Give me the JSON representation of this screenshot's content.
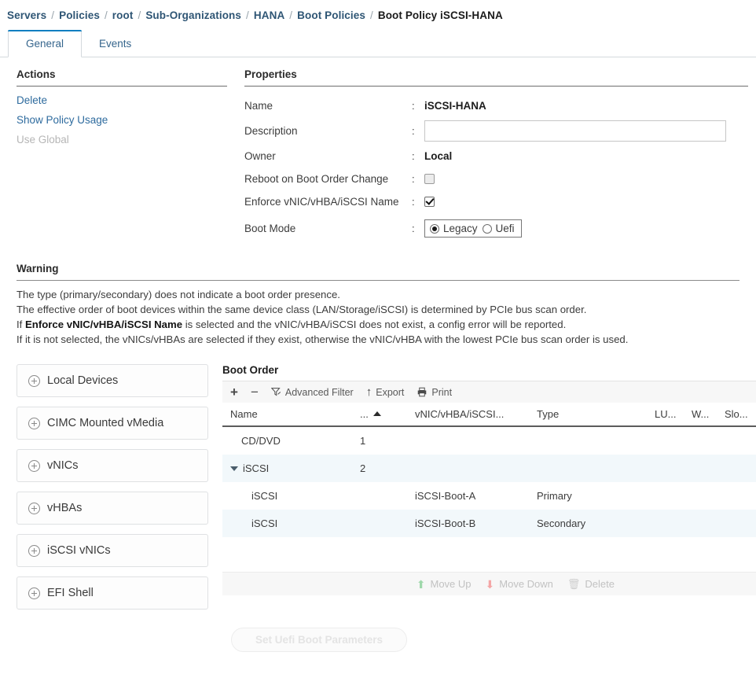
{
  "breadcrumb": {
    "separator": "/",
    "items": [
      {
        "label": "Servers",
        "current": false
      },
      {
        "label": "Policies",
        "current": false
      },
      {
        "label": "root",
        "current": false
      },
      {
        "label": "Sub-Organizations",
        "current": false
      },
      {
        "label": "HANA",
        "current": false
      },
      {
        "label": "Boot Policies",
        "current": false
      },
      {
        "label": "Boot Policy iSCSI-HANA",
        "current": true
      }
    ]
  },
  "tabs": [
    {
      "label": "General",
      "active": true
    },
    {
      "label": "Events",
      "active": false
    }
  ],
  "actions": {
    "title": "Actions",
    "items": [
      {
        "label": "Delete",
        "disabled": false
      },
      {
        "label": "Show Policy Usage",
        "disabled": false
      },
      {
        "label": "Use Global",
        "disabled": true
      }
    ]
  },
  "properties": {
    "title": "Properties",
    "name": {
      "label": "Name",
      "value": "iSCSI-HANA"
    },
    "description": {
      "label": "Description",
      "value": "",
      "placeholder": ""
    },
    "owner": {
      "label": "Owner",
      "value": "Local"
    },
    "reboot_on_boot_order_change": {
      "label": "Reboot on Boot Order Change",
      "checked": false
    },
    "enforce_name": {
      "label": "Enforce vNIC/vHBA/iSCSI Name",
      "checked": true
    },
    "boot_mode": {
      "label": "Boot Mode",
      "options": [
        "Legacy",
        "Uefi"
      ],
      "selected": "Legacy"
    },
    "colon": ":"
  },
  "warning": {
    "title": "Warning",
    "lines": [
      "The type (primary/secondary) does not indicate a boot order presence.",
      "The effective order of boot devices within the same device class (LAN/Storage/iSCSI) is determined by PCIe bus scan order.",
      "If it is not selected, the vNICs/vHBAs are selected if they exist, otherwise the vNIC/vHBA with the lowest PCIe bus scan order is used."
    ],
    "line3_prefix": "If ",
    "line3_bold": "Enforce vNIC/vHBA/iSCSI Name",
    "line3_suffix": " is selected and the vNIC/vHBA/iSCSI does not exist, a config error will be reported."
  },
  "devices": {
    "items": [
      {
        "label": "Local Devices"
      },
      {
        "label": "CIMC Mounted vMedia"
      },
      {
        "label": "vNICs"
      },
      {
        "label": "vHBAs"
      },
      {
        "label": "iSCSI vNICs"
      },
      {
        "label": "EFI Shell"
      }
    ]
  },
  "boot_order": {
    "title": "Boot Order",
    "toolbar": {
      "add": "+",
      "remove": "−",
      "advanced_filter": "Advanced Filter",
      "export": "Export",
      "print": "Print"
    },
    "columns": [
      {
        "label": "Name"
      },
      {
        "label": "...",
        "sorted": "asc"
      },
      {
        "label": "vNIC/vHBA/iSCSI..."
      },
      {
        "label": "Type"
      },
      {
        "label": "LU..."
      },
      {
        "label": "W..."
      },
      {
        "label": "Slo..."
      }
    ],
    "rows": [
      {
        "name": "CD/DVD",
        "order": "1",
        "vnic": "",
        "type": "",
        "lun": "",
        "wwn": "",
        "slot": "",
        "indent": 0,
        "expanded": null,
        "tint": false
      },
      {
        "name": "iSCSI",
        "order": "2",
        "vnic": "",
        "type": "",
        "lun": "",
        "wwn": "",
        "slot": "",
        "indent": 0,
        "expanded": true,
        "tint": true
      },
      {
        "name": "iSCSI",
        "order": "",
        "vnic": "iSCSI-Boot-A",
        "type": "Primary",
        "lun": "",
        "wwn": "",
        "slot": "",
        "indent": 1,
        "expanded": null,
        "tint": false
      },
      {
        "name": "iSCSI",
        "order": "",
        "vnic": "iSCSI-Boot-B",
        "type": "Secondary",
        "lun": "",
        "wwn": "",
        "slot": "",
        "indent": 1,
        "expanded": null,
        "tint": true
      }
    ],
    "footer": {
      "move_up": "Move Up",
      "move_down": "Move Down",
      "delete": "Delete"
    },
    "uefi_button": "Set Uefi Boot Parameters"
  },
  "colors": {
    "link": "#2e5574",
    "tab_active_accent": "#0f7fc1",
    "row_tint": "#f2f8fb",
    "move_up_arrow": "#9fd8ab",
    "move_down_arrow": "#f4a6a6"
  }
}
